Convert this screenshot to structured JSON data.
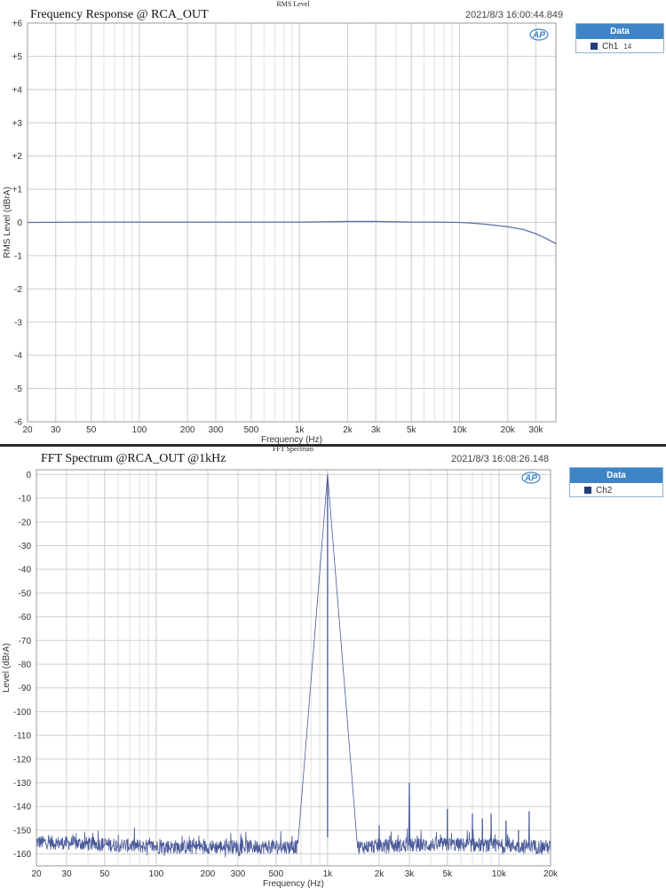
{
  "panels": [
    {
      "title": "Frequency Response @ RCA_OUT",
      "chart_label": "RMS Level",
      "timestamp": "2021/8/3 16:00:44.849",
      "logo": "AP",
      "legend": {
        "header": "Data",
        "entry": "Ch1",
        "extra": "14"
      }
    },
    {
      "title": "FFT Spectrum @RCA_OUT @1kHz",
      "chart_label": "FFT Spectrum",
      "timestamp": "2021/8/3 16:08:26.148",
      "logo": "AP",
      "legend": {
        "header": "Data",
        "entry": "Ch2",
        "extra": ""
      }
    }
  ],
  "chart_data": [
    {
      "type": "line",
      "title": "Frequency Response @ RCA_OUT",
      "xlabel": "Frequency (Hz)",
      "ylabel": "RMS Level (dBrA)",
      "x_scale": "log",
      "xlim": [
        20,
        40000
      ],
      "ylim": [
        -6,
        6
      ],
      "grid": true,
      "legend_position": "right",
      "line_color": "#5b6fa8",
      "xticks": [
        {
          "v": 20,
          "label": "20"
        },
        {
          "v": 30,
          "label": "30"
        },
        {
          "v": 50,
          "label": "50"
        },
        {
          "v": 100,
          "label": "100"
        },
        {
          "v": 200,
          "label": "200"
        },
        {
          "v": 300,
          "label": "300"
        },
        {
          "v": 500,
          "label": "500"
        },
        {
          "v": 1000,
          "label": "1k"
        },
        {
          "v": 2000,
          "label": "2k"
        },
        {
          "v": 3000,
          "label": "3k"
        },
        {
          "v": 5000,
          "label": "5k"
        },
        {
          "v": 10000,
          "label": "10k"
        },
        {
          "v": 20000,
          "label": "20k"
        },
        {
          "v": 30000,
          "label": "30k"
        }
      ],
      "yticks": [
        {
          "v": 6,
          "label": "+6"
        },
        {
          "v": 5,
          "label": "+5"
        },
        {
          "v": 4,
          "label": "+4"
        },
        {
          "v": 3,
          "label": "+3"
        },
        {
          "v": 2,
          "label": "+2"
        },
        {
          "v": 1,
          "label": "+1"
        },
        {
          "v": 0,
          "label": "0"
        },
        {
          "v": -1,
          "label": "-1"
        },
        {
          "v": -2,
          "label": "-2"
        },
        {
          "v": -3,
          "label": "-3"
        },
        {
          "v": -4,
          "label": "-4"
        },
        {
          "v": -5,
          "label": "-5"
        },
        {
          "v": -6,
          "label": "-6"
        }
      ],
      "series": [
        {
          "name": "Ch1",
          "x": [
            20,
            50,
            100,
            200,
            500,
            1000,
            1500,
            2000,
            3000,
            4000,
            5000,
            7000,
            10000,
            12000,
            15000,
            20000,
            25000,
            30000,
            35000,
            40000
          ],
          "y": [
            0.0,
            0.01,
            0.01,
            0.01,
            0.01,
            0.01,
            0.02,
            0.03,
            0.03,
            0.02,
            0.01,
            0.01,
            0.0,
            -0.02,
            -0.06,
            -0.13,
            -0.21,
            -0.34,
            -0.49,
            -0.64
          ]
        }
      ]
    },
    {
      "type": "line",
      "title": "FFT Spectrum @RCA_OUT @1kHz",
      "xlabel": "Frequency (Hz)",
      "ylabel": "Level (dBrA)",
      "x_scale": "log",
      "xlim": [
        20,
        20000
      ],
      "ylim": [
        -165,
        2
      ],
      "grid": true,
      "legend_position": "right",
      "line_color": "#4a5a99",
      "xticks": [
        {
          "v": 20,
          "label": "20"
        },
        {
          "v": 30,
          "label": "30"
        },
        {
          "v": 50,
          "label": "50"
        },
        {
          "v": 100,
          "label": "100"
        },
        {
          "v": 200,
          "label": "200"
        },
        {
          "v": 300,
          "label": "300"
        },
        {
          "v": 500,
          "label": "500"
        },
        {
          "v": 1000,
          "label": "1k"
        },
        {
          "v": 2000,
          "label": "2k"
        },
        {
          "v": 3000,
          "label": "3k"
        },
        {
          "v": 5000,
          "label": "5k"
        },
        {
          "v": 10000,
          "label": "10k"
        },
        {
          "v": 20000,
          "label": "20k"
        }
      ],
      "yticks": [
        {
          "v": 0,
          "label": "0"
        },
        {
          "v": -10,
          "label": "-10"
        },
        {
          "v": -20,
          "label": "-20"
        },
        {
          "v": -30,
          "label": "-30"
        },
        {
          "v": -40,
          "label": "-40"
        },
        {
          "v": -50,
          "label": "-50"
        },
        {
          "v": -60,
          "label": "-60"
        },
        {
          "v": -70,
          "label": "-70"
        },
        {
          "v": -80,
          "label": "-80"
        },
        {
          "v": -90,
          "label": "-90"
        },
        {
          "v": -100,
          "label": "-100"
        },
        {
          "v": -110,
          "label": "-110"
        },
        {
          "v": -120,
          "label": "-120"
        },
        {
          "v": -130,
          "label": "-130"
        },
        {
          "v": -140,
          "label": "-140"
        },
        {
          "v": -150,
          "label": "-150"
        },
        {
          "v": -160,
          "label": "-160"
        }
      ],
      "series": [
        {
          "name": "Ch2",
          "noise_floor": [
            {
              "x": 20,
              "y": -155
            },
            {
              "x": 50,
              "y": -156
            },
            {
              "x": 100,
              "y": -157
            },
            {
              "x": 300,
              "y": -157
            },
            {
              "x": 700,
              "y": -157
            },
            {
              "x": 900,
              "y": -153
            },
            {
              "x": 1100,
              "y": -153
            },
            {
              "x": 1500,
              "y": -157
            },
            {
              "x": 5000,
              "y": -156
            },
            {
              "x": 20000,
              "y": -157
            }
          ],
          "peaks": [
            {
              "x": 1000,
              "y": 0
            },
            {
              "x": 2000,
              "y": -148
            },
            {
              "x": 3000,
              "y": -130
            },
            {
              "x": 5000,
              "y": -141
            },
            {
              "x": 7000,
              "y": -143
            },
            {
              "x": 8000,
              "y": -145
            },
            {
              "x": 9000,
              "y": -143
            },
            {
              "x": 11000,
              "y": -146
            },
            {
              "x": 13000,
              "y": -150
            },
            {
              "x": 15000,
              "y": -142
            }
          ]
        }
      ]
    }
  ]
}
